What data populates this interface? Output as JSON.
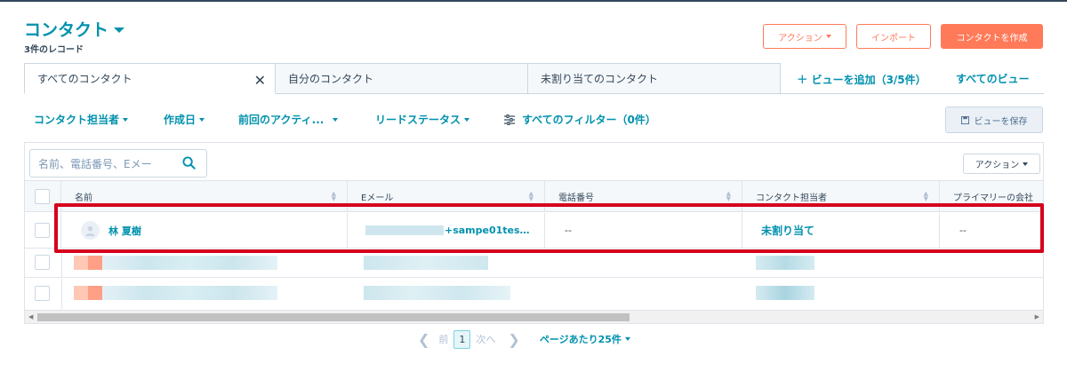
{
  "header": {
    "title": "コンタクト",
    "subtitle": "3件のレコード",
    "actions_label": "アクション",
    "import_label": "インポート",
    "create_label": "コンタクトを作成"
  },
  "tabs": [
    {
      "label": "すべてのコンタクト",
      "active": true
    },
    {
      "label": "自分のコンタクト",
      "active": false
    },
    {
      "label": "未割り当てのコンタクト",
      "active": false
    }
  ],
  "add_view_label": "ビューを追加（3/5件）",
  "all_views_label": "すべてのビュー",
  "filters": [
    {
      "label": "コンタクト担当者"
    },
    {
      "label": "作成日"
    },
    {
      "label": "前回のアクティ..."
    },
    {
      "label": "リードステータス"
    }
  ],
  "all_filters_label": "すべてのフィルター（0件）",
  "save_view_label": "ビューを保存",
  "search": {
    "placeholder": "名前、電話番号、Eメー"
  },
  "table_actions_label": "アクション",
  "columns": [
    "名前",
    "Eメール",
    "電話番号",
    "コンタクト担当者",
    "プライマリーの会社"
  ],
  "rows": [
    {
      "name": "林 夏樹",
      "email_suffix": "+sampe01tes…",
      "phone": "--",
      "owner": "未割り当て",
      "company": "--"
    }
  ],
  "pagination": {
    "prev_label": "前",
    "current_page": "1",
    "next_label": "次へ",
    "per_page_label": "ページあたり25件"
  },
  "colors": {
    "accent": "#0091ae",
    "orange": "#ff7a59",
    "highlight": "#d5001c"
  }
}
